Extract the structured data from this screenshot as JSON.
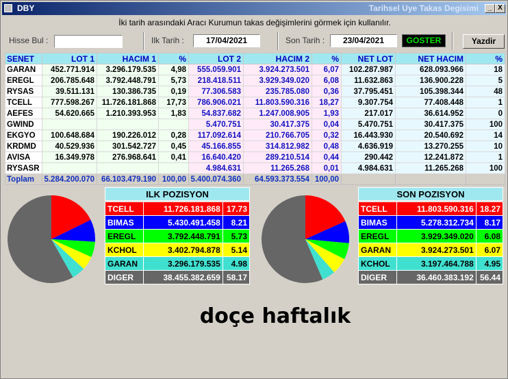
{
  "window": {
    "app_name": "DBY",
    "title": "Tarihsel Uye Takas Degisimi",
    "buttons": {
      "minimize": "_",
      "maximize": "□",
      "close": "X"
    }
  },
  "hint": "İki tarih arasındaki  Aracı Kurumun takas değişimlerini görmek için kullanılır.",
  "controls": {
    "hisse_label": "Hisse Bul :",
    "hisse_value": "",
    "ilk_label": "Ilk Tarih :",
    "ilk_value": "17/04/2021",
    "son_label": "Son Tarih :",
    "son_value": "23/04/2021",
    "goster_label": "GOSTER",
    "yazdir_label": "Yazdir"
  },
  "table": {
    "headers": [
      "SENET",
      "LOT 1",
      "HACIM 1",
      "%",
      "LOT 2",
      "HACIM 2",
      "%",
      "NET LOT",
      "NET HACIM",
      "%"
    ],
    "rows": [
      [
        "GARAN",
        "452.771.914",
        "3.296.179.535",
        "4,98",
        "555.059.901",
        "3.924.273.501",
        "6,07",
        "102.287.987",
        "628.093.966",
        "18"
      ],
      [
        "EREGL",
        "206.785.648",
        "3.792.448.791",
        "5,73",
        "218.418.511",
        "3.929.349.020",
        "6,08",
        "11.632.863",
        "136.900.228",
        "5"
      ],
      [
        "RYSAS",
        "39.511.131",
        "130.386.735",
        "0,19",
        "77.306.583",
        "235.785.080",
        "0,36",
        "37.795.451",
        "105.398.344",
        "48"
      ],
      [
        "TCELL",
        "777.598.267",
        "11.726.181.868",
        "17,73",
        "786.906.021",
        "11.803.590.316",
        "18,27",
        "9.307.754",
        "77.408.448",
        "1"
      ],
      [
        "AEFES",
        "54.620.665",
        "1.210.393.953",
        "1,83",
        "54.837.682",
        "1.247.008.905",
        "1,93",
        "217.017",
        "36.614.952",
        "0"
      ],
      [
        "GWIND",
        "",
        "",
        "",
        "5.470.751",
        "30.417.375",
        "0,04",
        "5.470.751",
        "30.417.375",
        "100"
      ],
      [
        "EKGYO",
        "100.648.684",
        "190.226.012",
        "0,28",
        "117.092.614",
        "210.766.705",
        "0,32",
        "16.443.930",
        "20.540.692",
        "14"
      ],
      [
        "KRDMD",
        "40.529.936",
        "301.542.727",
        "0,45",
        "45.166.855",
        "314.812.982",
        "0,48",
        "4.636.919",
        "13.270.255",
        "10"
      ],
      [
        "AVISA",
        "16.349.978",
        "276.968.641",
        "0,41",
        "16.640.420",
        "289.210.514",
        "0,44",
        "290.442",
        "12.241.872",
        "1"
      ],
      [
        "RYSASR",
        "",
        "",
        "",
        "4.984.631",
        "11.265.268",
        "0,01",
        "4.984.631",
        "11.265.268",
        "100"
      ]
    ],
    "total": [
      "Toplam",
      "5.284.200.070",
      "66.103.479.190",
      "100,00",
      "5.400.074.360",
      "64.593.373.554",
      "100,00",
      "",
      "",
      ""
    ]
  },
  "ilk": {
    "title": "ILK POZISYON",
    "rows": [
      {
        "name": "TCELL",
        "value": "11.726.181.868",
        "pct": "17.73",
        "p": 17.73,
        "color": "#ff0000",
        "text": "#ffffff"
      },
      {
        "name": "BIMAS",
        "value": "5.430.491.458",
        "pct": "8.21",
        "p": 8.21,
        "color": "#0000ff",
        "text": "#ffffff"
      },
      {
        "name": "EREGL",
        "value": "3.792.448.791",
        "pct": "5.73",
        "p": 5.73,
        "color": "#00ff00",
        "text": "#000000"
      },
      {
        "name": "KCHOL",
        "value": "3.402.794.878",
        "pct": "5.14",
        "p": 5.14,
        "color": "#ffff00",
        "text": "#000000"
      },
      {
        "name": "GARAN",
        "value": "3.296.179.535",
        "pct": "4.98",
        "p": 4.98,
        "color": "#40e0d0",
        "text": "#000000"
      },
      {
        "name": "DIGER",
        "value": "38.455.382.659",
        "pct": "58.17",
        "p": 58.17,
        "color": "#666666",
        "text": "#ffffff"
      }
    ]
  },
  "son": {
    "title": "SON POZISYON",
    "rows": [
      {
        "name": "TCELL",
        "value": "11.803.590.316",
        "pct": "18.27",
        "p": 18.27,
        "color": "#ff0000",
        "text": "#ffffff"
      },
      {
        "name": "BIMAS",
        "value": "5.278.312.734",
        "pct": "8.17",
        "p": 8.17,
        "color": "#0000ff",
        "text": "#ffffff"
      },
      {
        "name": "EREGL",
        "value": "3.929.349.020",
        "pct": "6.08",
        "p": 6.08,
        "color": "#00ff00",
        "text": "#000000"
      },
      {
        "name": "GARAN",
        "value": "3.924.273.501",
        "pct": "6.07",
        "p": 6.07,
        "color": "#ffff00",
        "text": "#000000"
      },
      {
        "name": "KCHOL",
        "value": "3.197.464.788",
        "pct": "4.95",
        "p": 4.95,
        "color": "#40e0d0",
        "text": "#000000"
      },
      {
        "name": "DIGER",
        "value": "36.460.383.192",
        "pct": "56.44",
        "p": 56.44,
        "color": "#666666",
        "text": "#ffffff"
      }
    ]
  },
  "caption": "doçe haftalık"
}
